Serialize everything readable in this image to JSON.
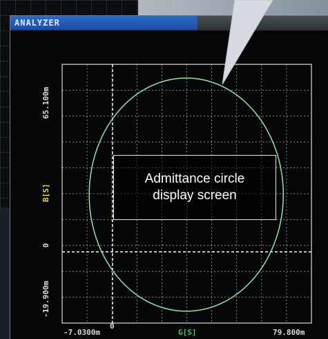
{
  "window": {
    "title": "ANALYZER"
  },
  "annotation": {
    "line1": "Admittance circle",
    "line2": "display screen"
  },
  "axes": {
    "y_label": "B[S]",
    "x_label": "G[S]",
    "y_max": "65.100m",
    "y_min": "-19.900m",
    "y_zero": "0",
    "x_min": "-7.0300m",
    "x_max": "79.800m",
    "x_zero": "0"
  },
  "colors": {
    "grid": "#d8d8d8",
    "trace": "#8fd6a0",
    "y_label": "#e6d24a",
    "x_label": "#3ec46a",
    "tick_text": "#d9d9d9",
    "title_bar": "#2b6ac8"
  },
  "chart_data": {
    "type": "scatter",
    "title": "",
    "xlabel": "G[S]",
    "ylabel": "B[S]",
    "xlim": [
      -0.00703,
      0.0798
    ],
    "ylim": [
      -0.0199,
      0.0651
    ],
    "grid": true,
    "trace_shape": "circle",
    "circle": {
      "center_g": 0.0362,
      "center_b": 0.0223,
      "radius_g": 0.0338,
      "radius_b": 0.0383
    }
  }
}
